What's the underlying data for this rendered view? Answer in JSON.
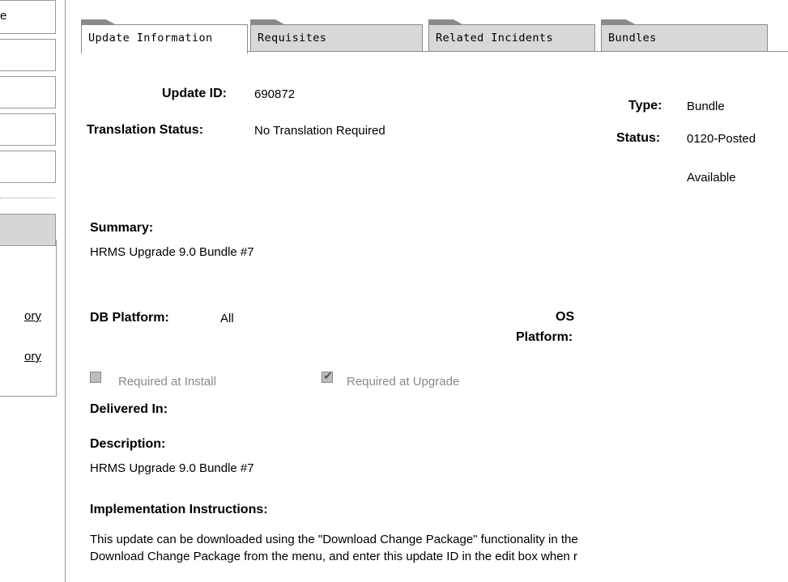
{
  "sidebar": {
    "top_text": "e",
    "link1": "ory",
    "link2": "ory"
  },
  "tabs": [
    {
      "label": "Update Information"
    },
    {
      "label": "Requisites"
    },
    {
      "label": "Related Incidents"
    },
    {
      "label": "Bundles"
    }
  ],
  "info": {
    "update_id_label": "Update ID:",
    "update_id_value": "690872",
    "translation_label": "Translation Status:",
    "translation_value": "No Translation Required",
    "type_label": "Type:",
    "type_value": "Bundle",
    "status_label": "Status:",
    "status_value": "0120-Posted",
    "status_value2": "Available",
    "summary_label": "Summary:",
    "summary_value": "HRMS Upgrade 9.0 Bundle #7",
    "db_platform_label": "DB Platform:",
    "db_platform_value": "All",
    "os_label_line1": "OS",
    "os_label_line2": "Platform:",
    "req_install_label": "Required at Install",
    "req_upgrade_label": "Required at Upgrade",
    "delivered_label": "Delivered In:",
    "description_label": "Description:",
    "description_value": "HRMS Upgrade 9.0 Bundle #7",
    "impl_label": "Implementation Instructions:",
    "impl_line1": "This update can be downloaded using the \"Download Change Package\" functionality in the",
    "impl_line2": "Download Change Package from the menu, and enter this update ID in the edit box when r"
  }
}
